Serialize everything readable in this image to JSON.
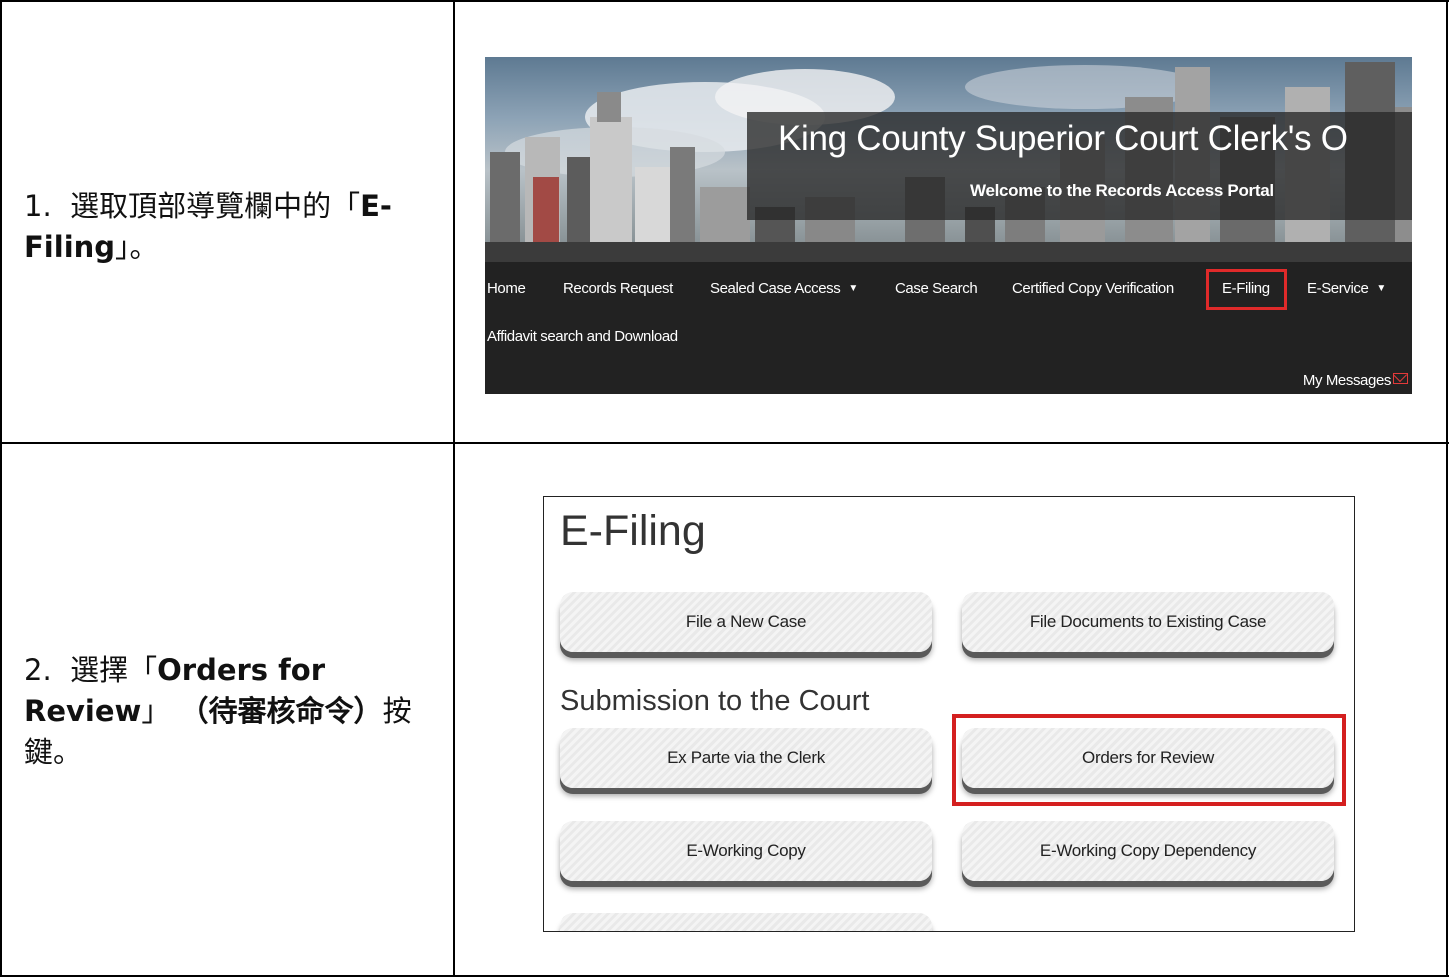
{
  "steps": [
    {
      "number": "1.",
      "text_before": "選取頂部導覽欄中的「",
      "bold": "E-Filing",
      "text_after": "」。"
    },
    {
      "number": "2.",
      "text_before": "選擇「",
      "bold": "Orders for Review",
      "text_mid": "」",
      "bold2": "（待審核命令）",
      "text_after": "按鍵。"
    }
  ],
  "kc_header": {
    "title": "King County Superior Court Clerk's O",
    "subtitle": "Welcome to the Records Access Portal",
    "nav": {
      "home": "Home",
      "records_request": "Records Request",
      "sealed_case_access": "Sealed Case Access",
      "case_search": "Case Search",
      "certified_copy": "Certified Copy Verification",
      "efiling": "E-Filing",
      "eservice": "E-Service",
      "affidavit": "Affidavit search and Download",
      "my_messages": "My Messages"
    },
    "highlight_color": "#e02a2a"
  },
  "efiling_panel": {
    "title": "E-Filing",
    "buttons_top": [
      "File a New Case",
      "File Documents to Existing Case"
    ],
    "subheading": "Submission to the Court",
    "buttons_submission": [
      "Ex Parte via the Clerk",
      "Orders for Review"
    ],
    "buttons_working": [
      "E-Working Copy",
      "E-Working Copy Dependency"
    ],
    "highlight_color": "#d41f1f"
  }
}
